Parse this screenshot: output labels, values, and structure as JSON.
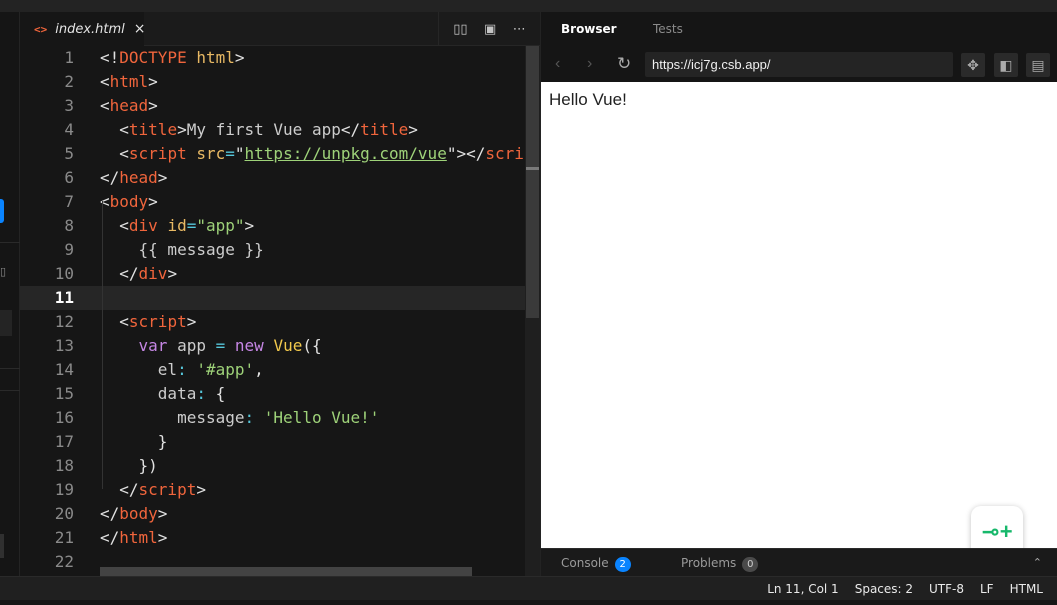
{
  "editor": {
    "tab": {
      "icon": "code-brackets-icon",
      "glyph": "<>",
      "label": "index.html",
      "close": "×"
    },
    "actions": [
      {
        "name": "split-editor-icon",
        "glyph": "▯▯"
      },
      {
        "name": "open-preview-icon",
        "glyph": "▣"
      },
      {
        "name": "more-actions-icon",
        "glyph": "⋯"
      }
    ],
    "current_line": 11
  },
  "preview": {
    "tabs": [
      "Browser",
      "Tests"
    ],
    "active_tab": "Browser",
    "nav": {
      "back": "‹",
      "forward": "›",
      "reload": "↻"
    },
    "url": "https://icj7g.csb.app/",
    "page_text": "Hello Vue!",
    "fab_glyph": "⊸+",
    "console": {
      "label": "Console",
      "count": "2"
    },
    "problems": {
      "label": "Problems",
      "count": "0"
    },
    "caret": "⌃"
  },
  "status": {
    "position": "Ln 11, Col 1",
    "spaces": "Spaces: 2",
    "encoding": "UTF-8",
    "eol": "LF",
    "language": "HTML"
  },
  "code_lines": [
    [
      [
        "punct",
        "<!"
      ],
      [
        "tag",
        "DOCTYPE"
      ],
      [
        "punct",
        " "
      ],
      [
        "attr",
        "html"
      ],
      [
        "punct",
        ">"
      ]
    ],
    [
      [
        "punct",
        "<"
      ],
      [
        "tag",
        "html"
      ],
      [
        "punct",
        ">"
      ]
    ],
    [
      [
        "punct",
        "<"
      ],
      [
        "tag",
        "head"
      ],
      [
        "punct",
        ">"
      ]
    ],
    [
      [
        "punct",
        "  <"
      ],
      [
        "tag",
        "title"
      ],
      [
        "punct",
        ">"
      ],
      [
        "plain",
        "My first Vue app"
      ],
      [
        "punct",
        "</"
      ],
      [
        "tag",
        "title"
      ],
      [
        "punct",
        ">"
      ]
    ],
    [
      [
        "punct",
        "  <"
      ],
      [
        "tag",
        "script"
      ],
      [
        "punct",
        " "
      ],
      [
        "attr",
        "src"
      ],
      [
        "op",
        "="
      ],
      [
        "punct",
        "\""
      ],
      [
        "url",
        "https://unpkg.com/vue"
      ],
      [
        "punct",
        "\"></"
      ],
      [
        "tag",
        "script"
      ]
    ],
    [
      [
        "punct",
        "</"
      ],
      [
        "tag",
        "head"
      ],
      [
        "punct",
        ">"
      ]
    ],
    [
      [
        "punct",
        "<"
      ],
      [
        "tag",
        "body"
      ],
      [
        "punct",
        ">"
      ]
    ],
    [
      [
        "punct",
        "  <"
      ],
      [
        "tag",
        "div"
      ],
      [
        "punct",
        " "
      ],
      [
        "attr",
        "id"
      ],
      [
        "op",
        "="
      ],
      [
        "str",
        "\"app\""
      ],
      [
        "punct",
        ">"
      ]
    ],
    [
      [
        "plain",
        "    {{ message }}"
      ]
    ],
    [
      [
        "punct",
        "  </"
      ],
      [
        "tag",
        "div"
      ],
      [
        "punct",
        ">"
      ]
    ],
    [],
    [
      [
        "punct",
        "  <"
      ],
      [
        "tag",
        "script"
      ],
      [
        "punct",
        ">"
      ]
    ],
    [
      [
        "plain",
        "    "
      ],
      [
        "kw",
        "var"
      ],
      [
        "plain",
        " app "
      ],
      [
        "op",
        "="
      ],
      [
        "plain",
        " "
      ],
      [
        "kw",
        "new"
      ],
      [
        "plain",
        " "
      ],
      [
        "fn",
        "Vue"
      ],
      [
        "punct",
        "({"
      ]
    ],
    [
      [
        "plain",
        "      el"
      ],
      [
        "op",
        ":"
      ],
      [
        "plain",
        " "
      ],
      [
        "str",
        "'#app'"
      ],
      [
        "punct",
        ","
      ]
    ],
    [
      [
        "plain",
        "      data"
      ],
      [
        "op",
        ":"
      ],
      [
        "plain",
        " "
      ],
      [
        "punct",
        "{"
      ]
    ],
    [
      [
        "plain",
        "        message"
      ],
      [
        "op",
        ":"
      ],
      [
        "plain",
        " "
      ],
      [
        "str",
        "'Hello Vue!'"
      ]
    ],
    [
      [
        "punct",
        "      }"
      ]
    ],
    [
      [
        "punct",
        "    })"
      ]
    ],
    [
      [
        "punct",
        "  </"
      ],
      [
        "tag",
        "script"
      ],
      [
        "punct",
        ">"
      ]
    ],
    [
      [
        "punct",
        "</"
      ],
      [
        "tag",
        "body"
      ],
      [
        "punct",
        ">"
      ]
    ],
    [
      [
        "punct",
        "</"
      ],
      [
        "tag",
        "html"
      ],
      [
        "punct",
        ">"
      ]
    ],
    []
  ]
}
